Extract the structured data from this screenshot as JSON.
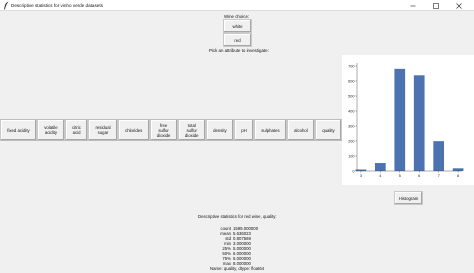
{
  "window": {
    "title": "Descriptive statistics for vinho verde datasets",
    "minimize_icon": "minimize-icon",
    "maximize_icon": "maximize-icon",
    "close_icon": "close-icon"
  },
  "wine_choice": {
    "label": "Wine choice:",
    "options": [
      "white",
      "red"
    ]
  },
  "attribute_prompt": "Pick an attribute to investigate:",
  "attributes": [
    "fixed acidity",
    "volatile\nacidity",
    "citric\nacid",
    "residual\nsugar",
    "chlorides",
    "free\nsulfur\ndioxide",
    "total\nsulfur\ndioxide",
    "density",
    "pH",
    "sulphates",
    "alcohol",
    "quality"
  ],
  "histogram_button": "Histogram",
  "stats": {
    "title": "Descriptive statistics for red wine, quality:",
    "rows": [
      {
        "k": "count",
        "v": "1599.000000"
      },
      {
        "k": "mean",
        "v": "5.636023"
      },
      {
        "k": "std",
        "v": "0.807569"
      },
      {
        "k": "min",
        "v": "3.000000"
      },
      {
        "k": "25%",
        "v": "5.000000"
      },
      {
        "k": "50%",
        "v": "6.000000"
      },
      {
        "k": "75%",
        "v": "6.000000"
      },
      {
        "k": "max",
        "v": "8.000000"
      }
    ],
    "footer": "Name: quality, dtype: float64"
  },
  "chart_data": {
    "type": "bar",
    "x": [
      3,
      4,
      5,
      6,
      7,
      8
    ],
    "values": [
      10,
      53,
      681,
      638,
      199,
      18
    ],
    "xticks": [
      3,
      4,
      5,
      6,
      7,
      8
    ],
    "yticks": [
      0,
      100,
      200,
      300,
      400,
      500,
      600,
      700
    ],
    "xlim": [
      2.8,
      8.2
    ],
    "ylim": [
      0,
      720
    ],
    "bar_color": "#4c72b0",
    "grid": false
  }
}
